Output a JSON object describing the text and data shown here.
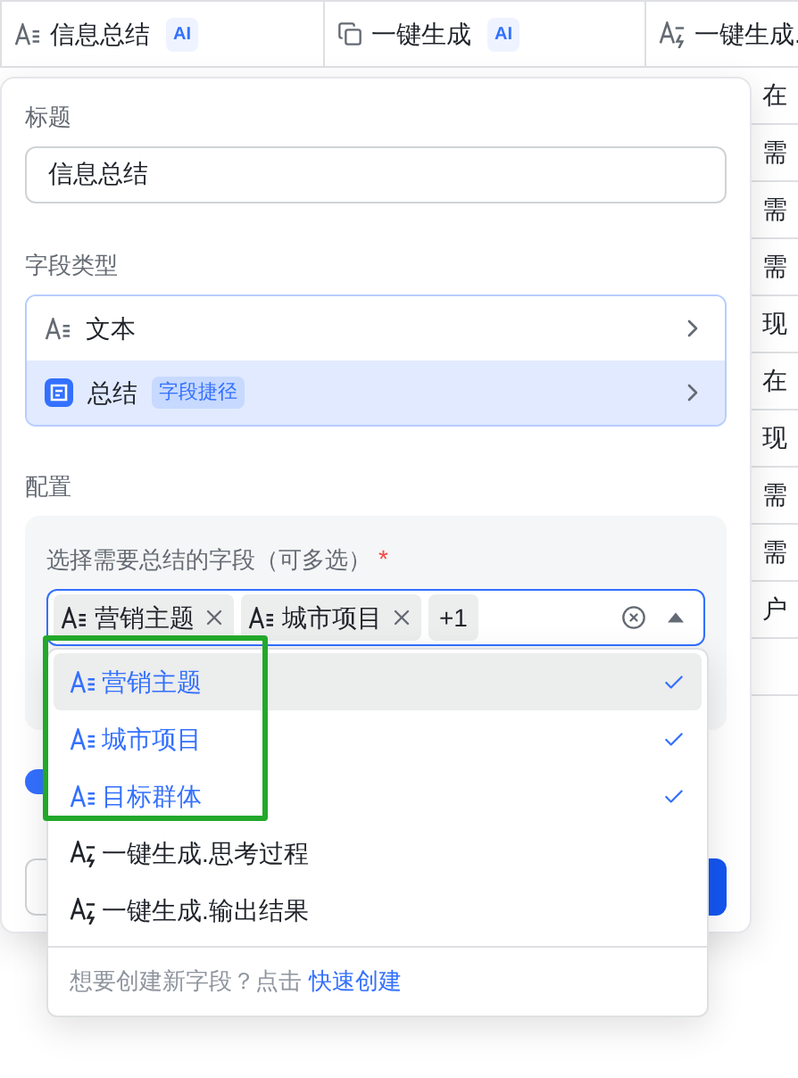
{
  "table": {
    "columns": [
      {
        "label": "信息总结",
        "kind": "text",
        "ai_badge": "AI"
      },
      {
        "label": "一键生成",
        "kind": "copy",
        "ai_badge": "AI"
      },
      {
        "label": "一键生成.",
        "kind": "ai-text"
      }
    ],
    "column_3_cells": [
      "在",
      "需",
      "需",
      "需",
      "现",
      "在",
      "现",
      "需",
      "需",
      "户"
    ]
  },
  "field_panel": {
    "title_label": "标题",
    "title_value": "信息总结",
    "type_label": "字段类型",
    "types": [
      {
        "label": "文本",
        "kind": "text",
        "selected": false
      },
      {
        "label": "总结",
        "kind": "summary",
        "tag": "字段捷径",
        "selected": true
      }
    ],
    "config_label": "配置",
    "select": {
      "label": "选择需要总结的字段（可多选）",
      "required_mark": "*",
      "tags": [
        "营销主题",
        "城市项目"
      ],
      "more": "+1",
      "open": true
    },
    "toggle": {
      "on": true
    }
  },
  "dropdown": {
    "options": [
      {
        "label": "营销主题",
        "kind": "text",
        "selected": true,
        "hovered": true
      },
      {
        "label": "城市项目",
        "kind": "text",
        "selected": true,
        "hovered": false
      },
      {
        "label": "目标群体",
        "kind": "text",
        "selected": true,
        "hovered": false
      },
      {
        "label": "一键生成.思考过程",
        "kind": "ai-text",
        "selected": false,
        "hovered": false
      },
      {
        "label": "一键生成.输出结果",
        "kind": "ai-text",
        "selected": false,
        "hovered": false
      }
    ],
    "footer_text": "想要创建新字段？点击",
    "footer_link": "快速创建"
  }
}
